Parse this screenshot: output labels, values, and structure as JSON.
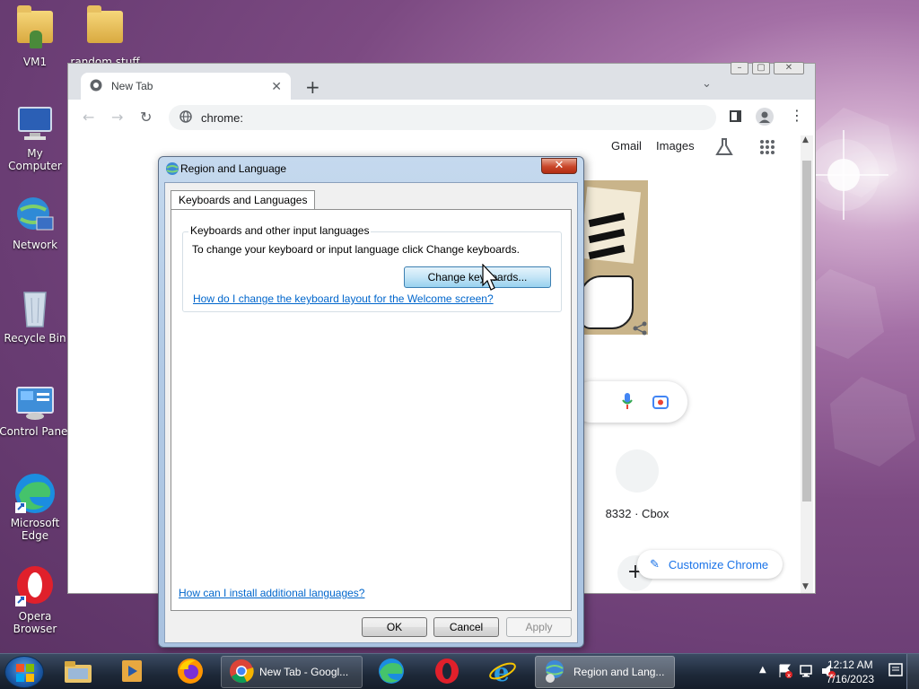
{
  "desktop": {
    "icons": [
      {
        "label": "VM1",
        "icon": "folder-user-icon"
      },
      {
        "label": "random stuff",
        "icon": "folder-icon"
      },
      {
        "label": "My Computer",
        "icon": "computer-icon"
      },
      {
        "label": "Network",
        "icon": "network-icon"
      },
      {
        "label": "Recycle Bin",
        "icon": "recycle-bin-icon"
      },
      {
        "label": "Control Panel",
        "icon": "control-panel-icon"
      },
      {
        "label": "Microsoft Edge",
        "icon": "edge-icon"
      },
      {
        "label": "Opera Browser",
        "icon": "opera-icon"
      }
    ]
  },
  "chrome": {
    "tab_title": "New Tab",
    "address": "chrome:",
    "gmail": "Gmail",
    "images": "Images",
    "shortcut_label": "8332 · Cbox",
    "customize": "Customize Chrome"
  },
  "dialog": {
    "title": "Region and Language",
    "tab": "Keyboards and Languages",
    "group_title": "Keyboards and other input languages",
    "group_desc": "To change your keyboard or input language click Change keyboards.",
    "change_button": "Change keyboards...",
    "welcome_link": "How do I change the keyboard layout for the Welcome screen?",
    "install_link": "How can I install additional languages?",
    "ok": "OK",
    "cancel": "Cancel",
    "apply": "Apply"
  },
  "taskbar": {
    "chrome_item": "New Tab - Googl...",
    "region_item": "Region and Lang...",
    "time": "12:12 AM",
    "date": "7/16/2023"
  },
  "colors": {
    "link": "#0066cc",
    "accent_blue": "#3c7fb1"
  }
}
